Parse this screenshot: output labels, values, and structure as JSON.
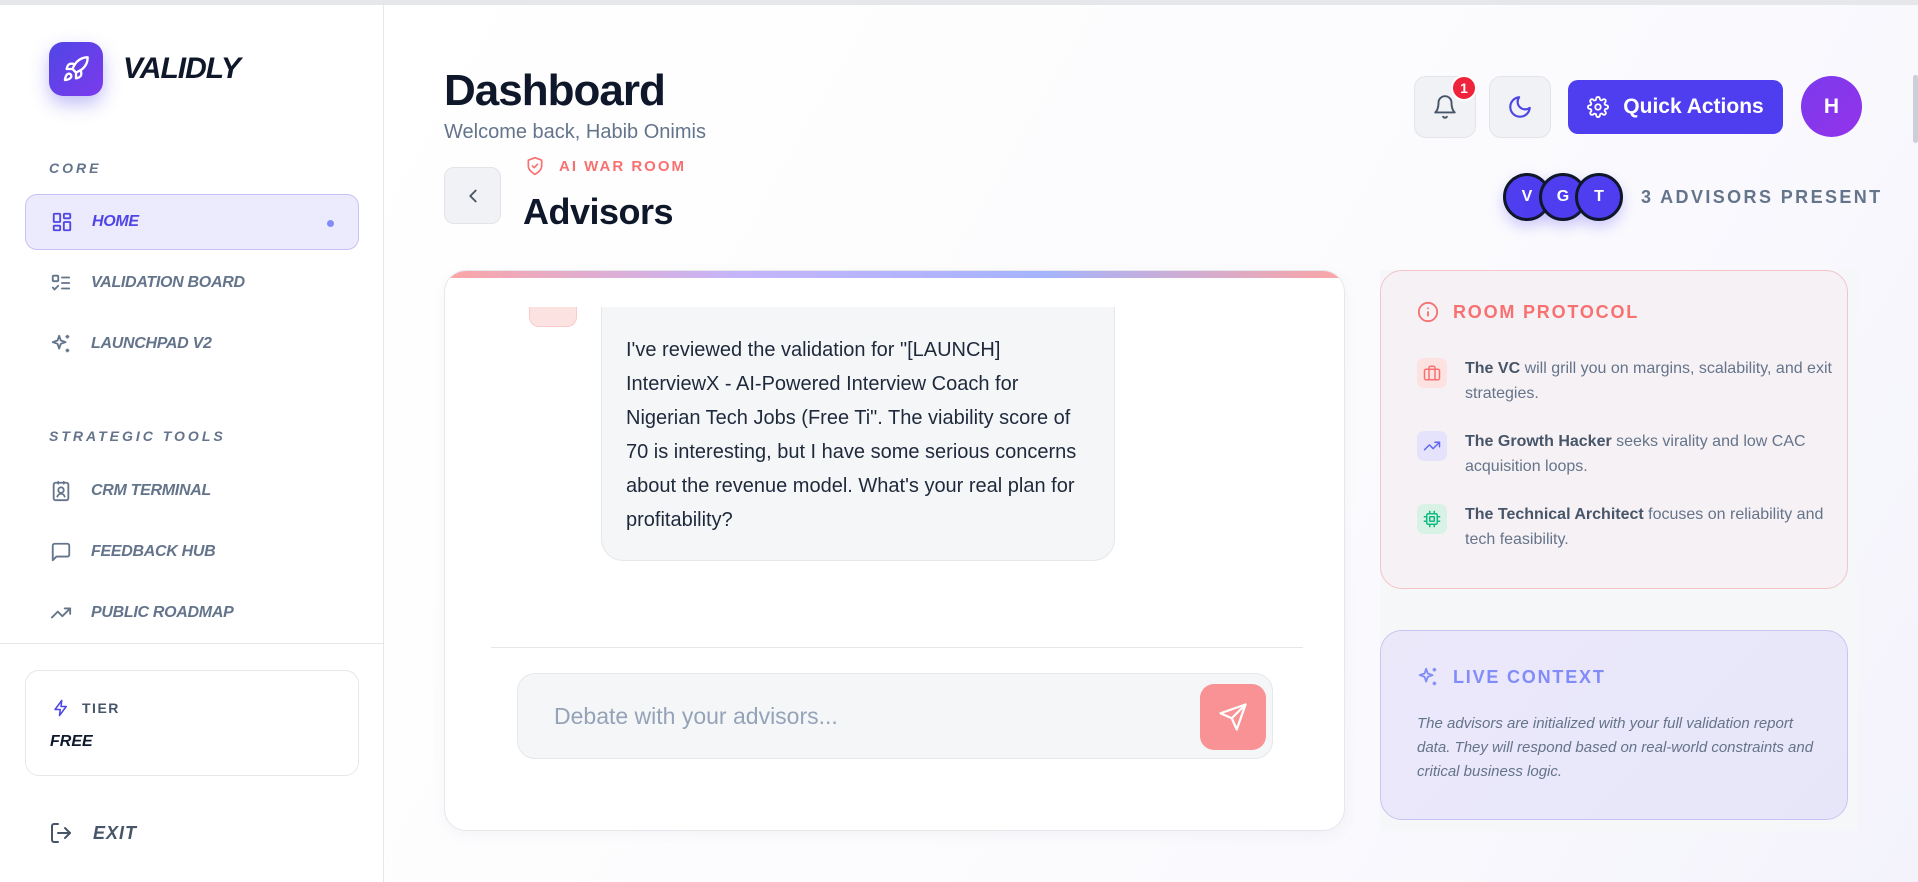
{
  "brand": {
    "name": "VALIDLY",
    "icon": "rocket-icon"
  },
  "sidebar": {
    "core_label": "CORE",
    "core_items": [
      {
        "label": "HOME",
        "icon": "grid-icon",
        "active": true
      },
      {
        "label": "VALIDATION BOARD",
        "icon": "checklist-icon",
        "active": false
      },
      {
        "label": "LAUNCHPAD V2",
        "icon": "sparkles-icon",
        "active": false
      }
    ],
    "tools_label": "STRATEGIC TOOLS",
    "tool_items": [
      {
        "label": "CRM TERMINAL",
        "icon": "contact-card-icon"
      },
      {
        "label": "FEEDBACK HUB",
        "icon": "message-square-icon"
      },
      {
        "label": "PUBLIC ROADMAP",
        "icon": "trending-up-icon"
      }
    ],
    "tier": {
      "label": "TIER",
      "value": "FREE",
      "icon": "lightning-icon"
    },
    "exit_label": "EXIT"
  },
  "header": {
    "title": "Dashboard",
    "welcome": "Welcome back, Habib Onimis",
    "notifications_count": "1",
    "quick_actions_label": "Quick Actions",
    "user_initial": "H"
  },
  "room": {
    "kicker": "AI WAR ROOM",
    "title": "Advisors",
    "advisor_initials": [
      "V",
      "G",
      "T"
    ],
    "present_label": "3 ADVISORS PRESENT"
  },
  "chat": {
    "message": "I've reviewed the validation for \"[LAUNCH] InterviewX - AI-Powered Interview Coach for Nigerian Tech Jobs (Free Ti\". The viability score of 70 is interesting, but I have some serious concerns about the revenue model. What's your real plan for profitability?",
    "input_placeholder": "Debate with your advisors..."
  },
  "protocol": {
    "title": "ROOM PROTOCOL",
    "items": [
      {
        "role": "The VC",
        "text": " will grill you on margins, scalability, and exit strategies.",
        "icon": "briefcase-icon"
      },
      {
        "role": "The Growth Hacker",
        "text": " seeks virality and low CAC acquisition loops.",
        "icon": "trending-up-icon"
      },
      {
        "role": "The Technical Architect",
        "text": " focuses on reliability and tech feasibility.",
        "icon": "cpu-icon"
      }
    ]
  },
  "live_context": {
    "title": "LIVE CONTEXT",
    "text": "The advisors are initialized with your full validation report data. They will respond based on real-world constraints and critical business logic."
  },
  "colors": {
    "accent": "#4f3df0",
    "danger": "#f87171",
    "live": "#818cf8",
    "send": "#f89294"
  }
}
